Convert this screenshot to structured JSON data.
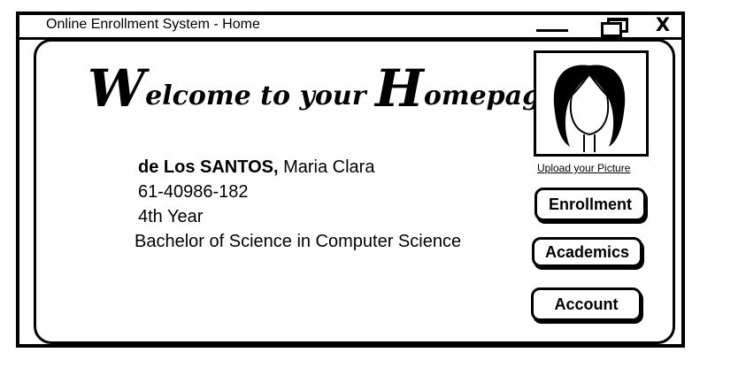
{
  "window": {
    "title": "Online Enrollment System  - Home",
    "close_label": "X"
  },
  "welcome": {
    "heading": "Welcome to your Homepage!"
  },
  "student": {
    "surname": "de Los SANTOS,",
    "given_names": " Maria Clara",
    "id_number": "61-40986-182",
    "year_level": "4th Year",
    "program": "Bachelor of Science in Computer Science"
  },
  "profile": {
    "upload_label": "Upload your Picture",
    "avatar_icon": "female-silhouette-icon"
  },
  "nav": {
    "enrollment": "Enrollment",
    "academics": "Academics",
    "account": "Account"
  }
}
